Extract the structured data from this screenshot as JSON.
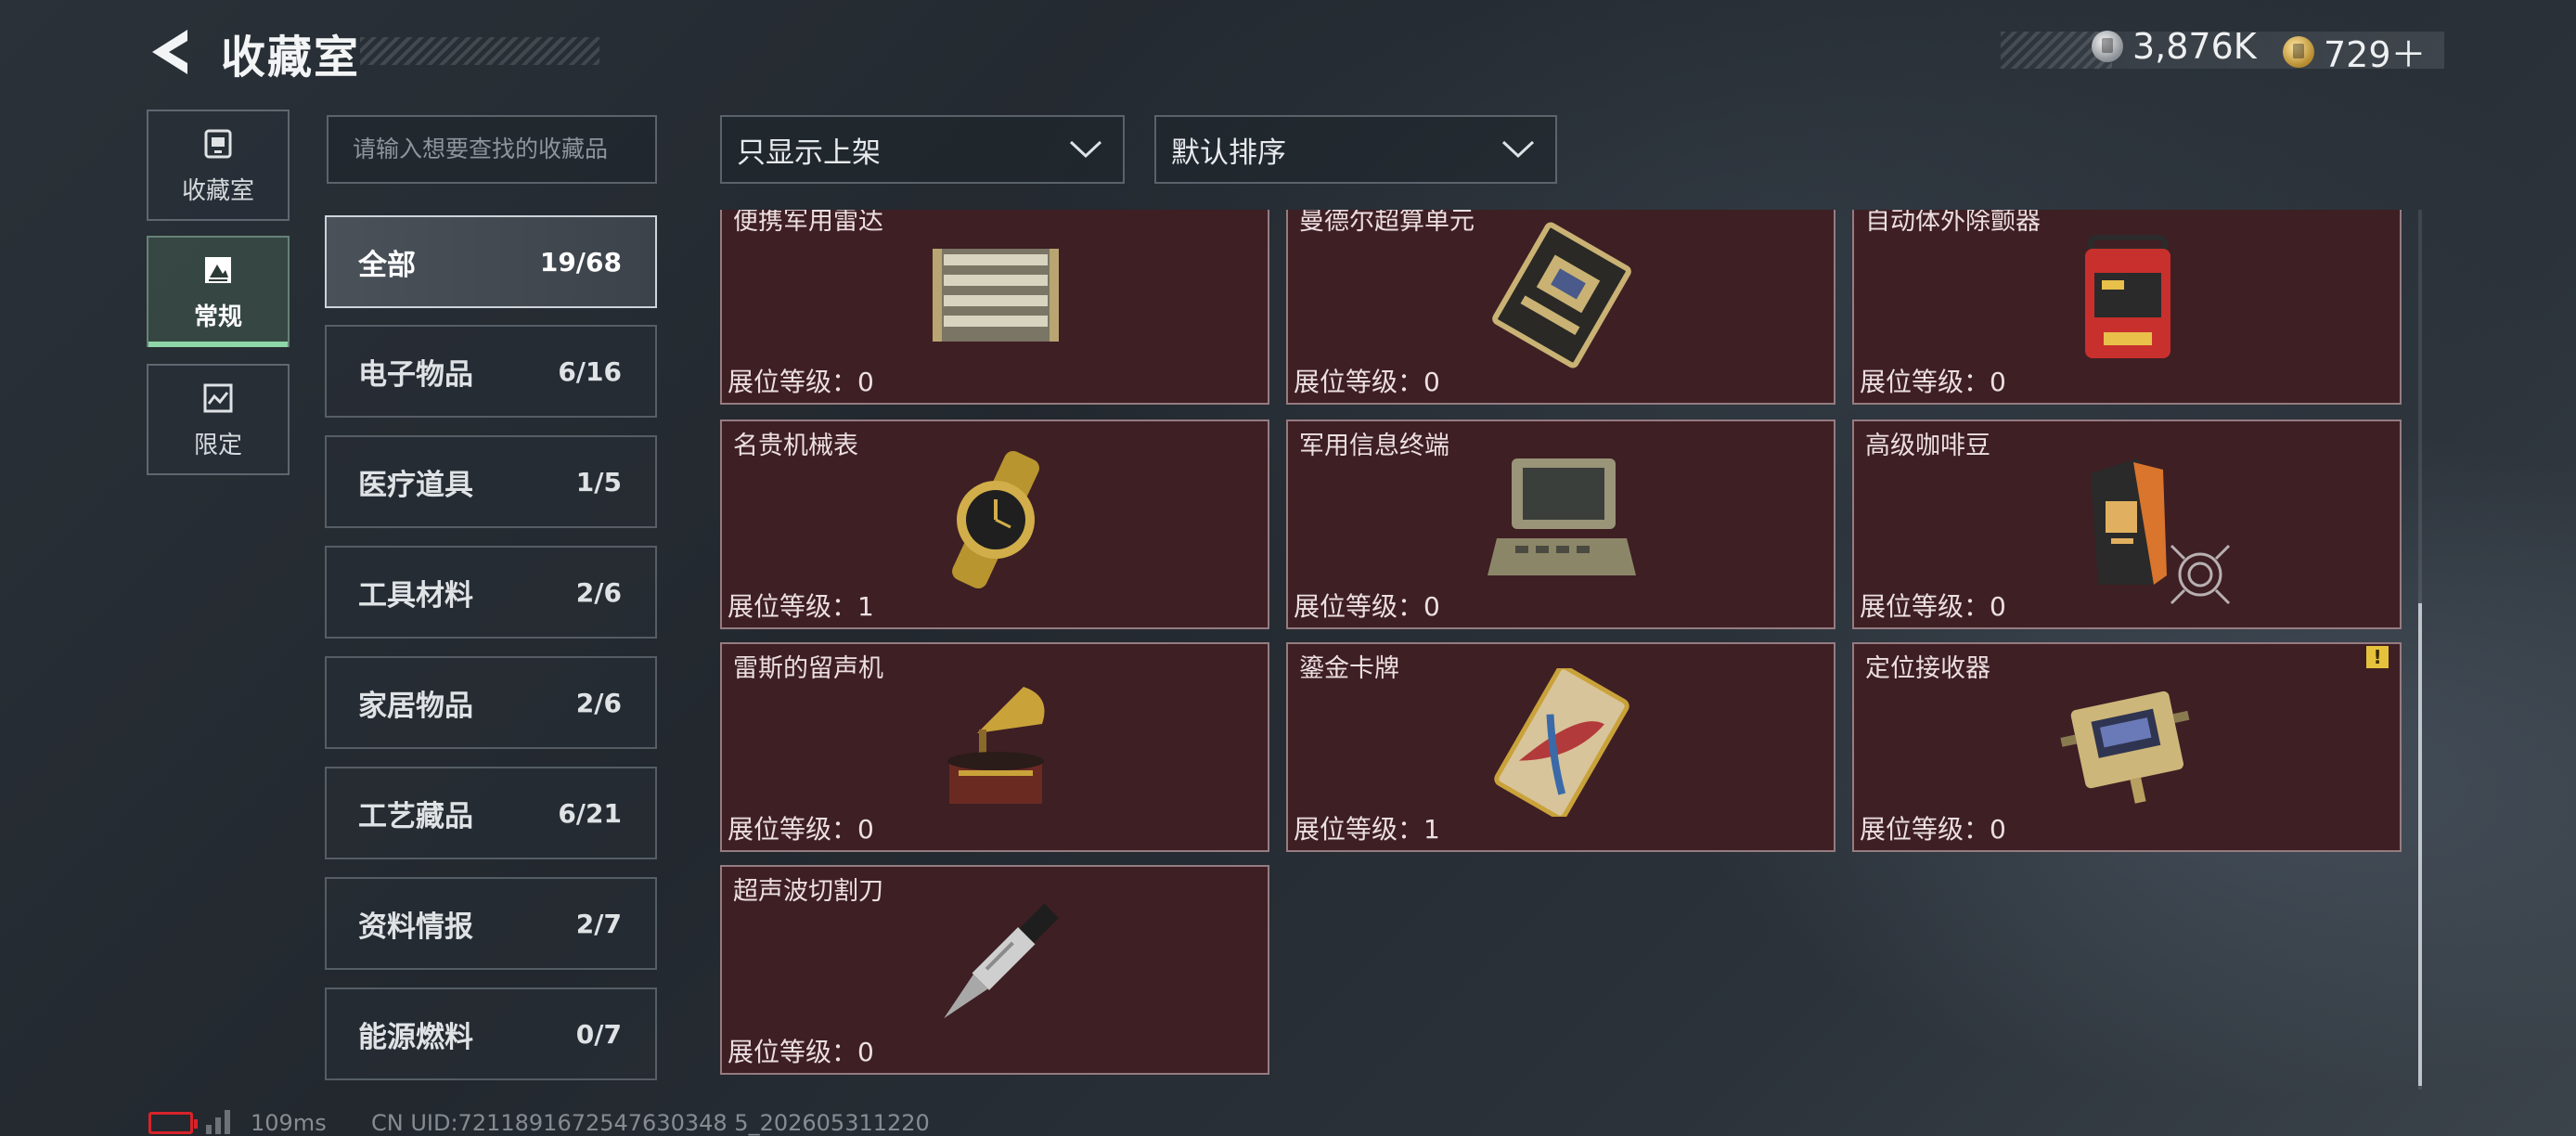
{
  "header": {
    "title": "收藏室",
    "currency_silver": "3,876K",
    "currency_gold": "729＋"
  },
  "side_nav": [
    {
      "label": "收藏室",
      "icon": "collection-icon"
    },
    {
      "label": "常规",
      "icon": "regular-icon",
      "active": true
    },
    {
      "label": "限定",
      "icon": "limited-icon"
    }
  ],
  "search": {
    "placeholder": "请输入想要查找的收藏品"
  },
  "filters": {
    "display_filter": "只显示上架",
    "sort": "默认排序"
  },
  "categories": [
    {
      "name": "全部",
      "count": "19/68",
      "active": true
    },
    {
      "name": "电子物品",
      "count": "6/16"
    },
    {
      "name": "医疗道具",
      "count": "1/5"
    },
    {
      "name": "工具材料",
      "count": "2/6"
    },
    {
      "name": "家居物品",
      "count": "2/6"
    },
    {
      "name": "工艺藏品",
      "count": "6/21"
    },
    {
      "name": "资料情报",
      "count": "2/7"
    },
    {
      "name": "能源燃料",
      "count": "0/7"
    }
  ],
  "items": [
    {
      "name": "便携军用雷达",
      "level": "展位等级：0",
      "icon": "radar-icon"
    },
    {
      "name": "曼德尔超算单元",
      "level": "展位等级：0",
      "icon": "circuit-board-icon"
    },
    {
      "name": "自动体外除颤器",
      "level": "展位等级：0",
      "icon": "defibrillator-icon"
    },
    {
      "name": "名贵机械表",
      "level": "展位等级：1",
      "icon": "watch-icon"
    },
    {
      "name": "军用信息终端",
      "level": "展位等级：0",
      "icon": "terminal-case-icon"
    },
    {
      "name": "高级咖啡豆",
      "level": "展位等级：0",
      "icon": "coffee-bag-icon",
      "has_target": true
    },
    {
      "name": "雷斯的留声机",
      "level": "展位等级：0",
      "icon": "gramophone-icon"
    },
    {
      "name": "鎏金卡牌",
      "level": "展位等级：1",
      "icon": "gilded-card-icon"
    },
    {
      "name": "定位接收器",
      "level": "展位等级：0",
      "icon": "receiver-icon",
      "warning": "!"
    },
    {
      "name": "超声波切割刀",
      "level": "展位等级：0",
      "icon": "cutter-knife-icon"
    }
  ],
  "footer": {
    "ping": "109ms",
    "uid": "CN UID:7211891672547630348 5_202605311220"
  },
  "colors": {
    "card_bg": "#3e1f24",
    "active_tab_accent": "#8fd6a8",
    "battery_low": "#d8232a",
    "warning": "#e6c23c"
  }
}
